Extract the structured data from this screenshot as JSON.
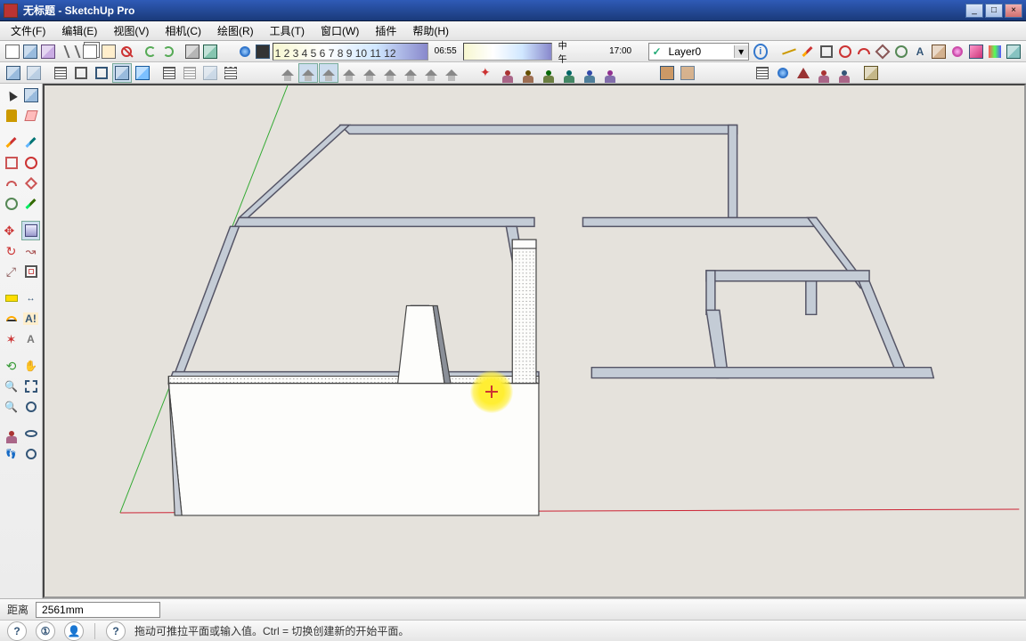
{
  "window": {
    "title": "无标题 - SketchUp Pro",
    "minimize": "_",
    "maximize": "□",
    "close": "×"
  },
  "menu": {
    "file": "文件(F)",
    "edit": "编辑(E)",
    "view": "视图(V)",
    "camera": "相机(C)",
    "draw": "绘图(R)",
    "tools": "工具(T)",
    "window": "窗口(W)",
    "plugins": "插件",
    "help": "帮助(H)"
  },
  "time_ruler": {
    "ticks": "1 2 3 4 5 6 7 8 9 10 11 12",
    "start_time": "06:55",
    "noon": "中午",
    "end_time": "17:00"
  },
  "layer": {
    "check": "✓",
    "name": "Layer0",
    "dropdown": "▾",
    "info": "i"
  },
  "status": {
    "measure_label": "距离",
    "measure_value": "2561mm"
  },
  "help": {
    "btn1": "?",
    "btn2": "①",
    "btn3": "👤",
    "btn4": "?",
    "text": "拖动可推拉平面或输入值。Ctrl = 切换创建新的开始平面。"
  },
  "icons": {
    "select": "↖",
    "eraser": "◧",
    "line": "／",
    "pencil": "✎",
    "rect": "▭",
    "circ": "○",
    "arc": "◡",
    "poly": "⬠",
    "move": "✥",
    "push": "⇱",
    "rotate": "↻",
    "follow": "↝",
    "scale": "⤢",
    "offset": "⊡",
    "tape": "▭",
    "protractor": "◔",
    "text": "A",
    "dim": "↔",
    "paint": "▮",
    "orbit": "⟲",
    "pan": "✋",
    "zoom": "🔍",
    "walk": "🚶",
    "look": "👁"
  }
}
